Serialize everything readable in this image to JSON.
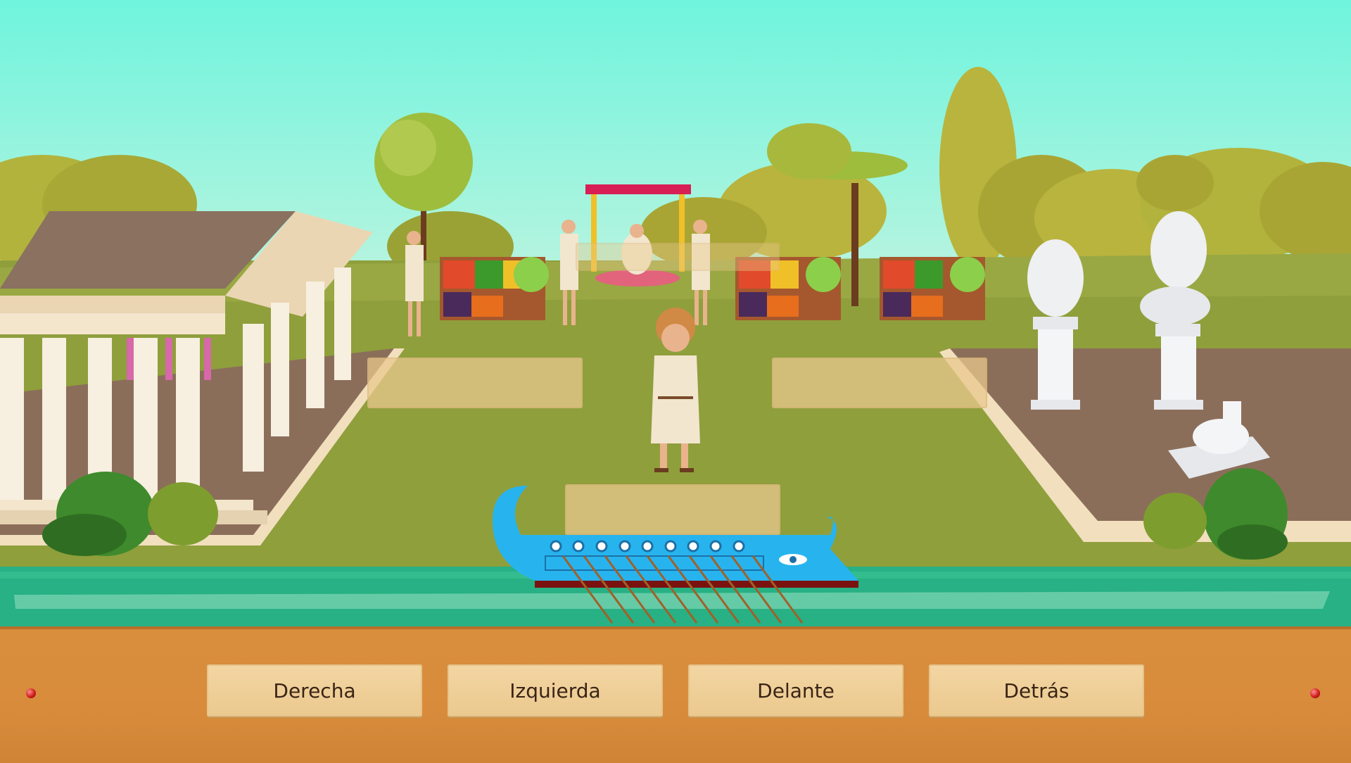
{
  "game": {
    "answers": [
      {
        "label": "Derecha"
      },
      {
        "label": "Izquierda"
      },
      {
        "label": "Delante"
      },
      {
        "label": "Detrás"
      }
    ]
  },
  "colors": {
    "sky": "#6ff4dd",
    "grass": "#8f9f3c",
    "river": "#27b184",
    "bar": "#d98e3e",
    "button": "#efd09a",
    "boat": "#27b4ee"
  }
}
